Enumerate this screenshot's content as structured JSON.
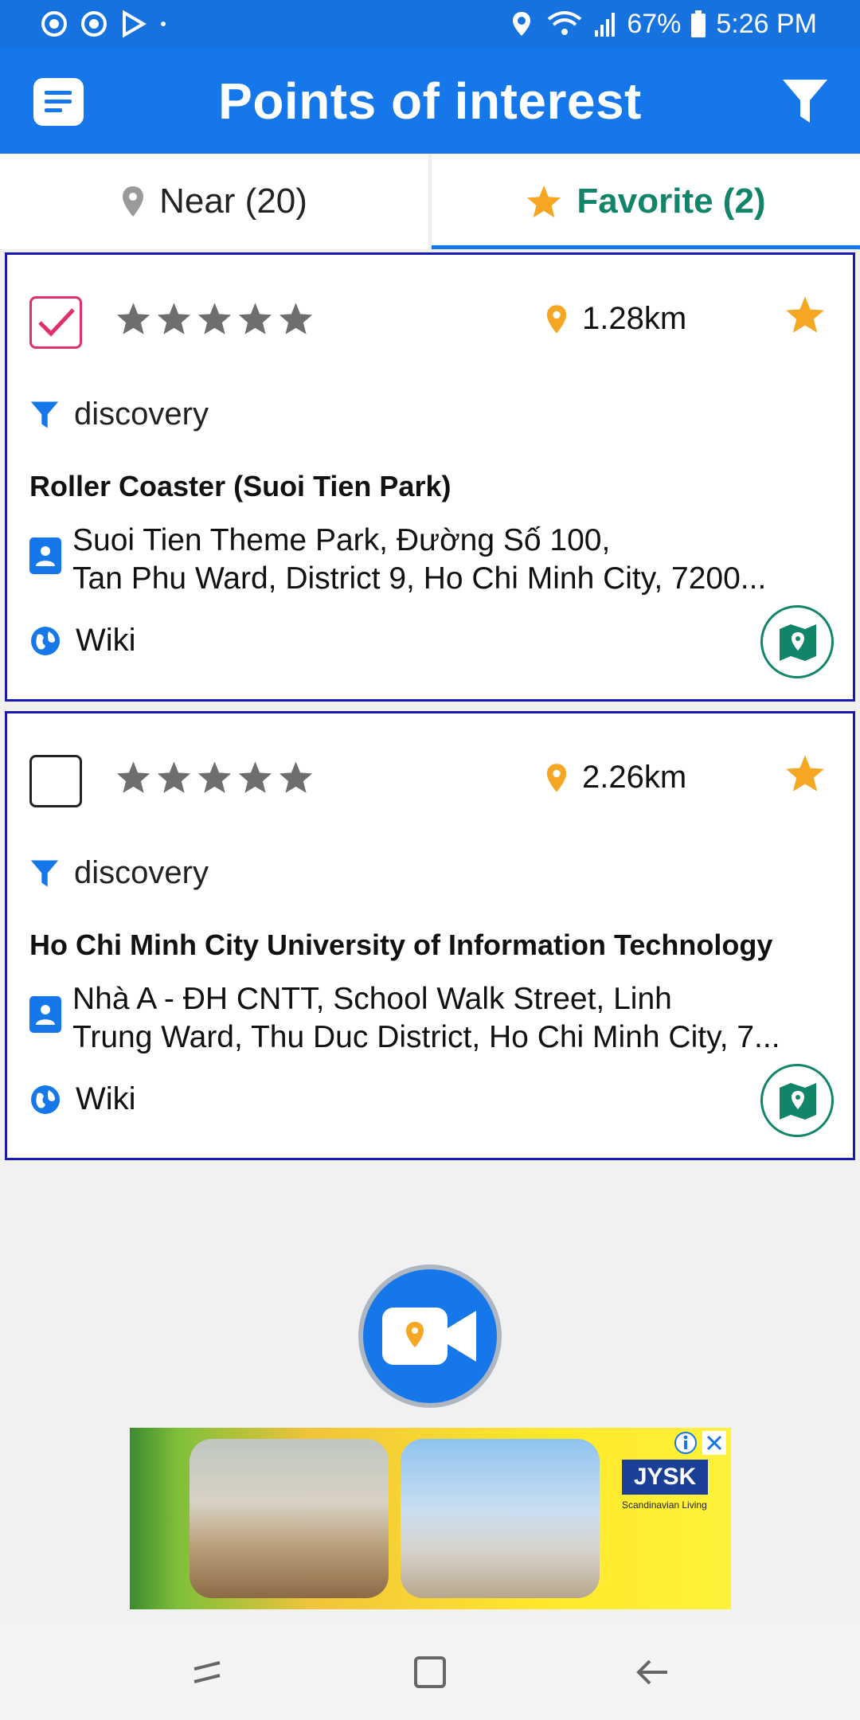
{
  "status_bar": {
    "battery": "67%",
    "time": "5:26 PM"
  },
  "app_bar": {
    "title": "Points of interest"
  },
  "tabs": [
    {
      "label": "Near (20)",
      "icon": "pin-icon",
      "selected": false
    },
    {
      "label": "Favorite (2)",
      "icon": "star-icon",
      "selected": true
    }
  ],
  "pois": [
    {
      "checked": true,
      "rating": 0,
      "distance": "1.28km",
      "favorite": true,
      "category": "discovery",
      "name": "Roller Coaster (Suoi Tien Park)",
      "address_line1": "Suoi Tien Theme Park, Đường Số 100,",
      "address_line2": "Tan Phu Ward, District 9, Ho Chi Minh City, 7200...",
      "link": "Wiki"
    },
    {
      "checked": false,
      "rating": 0,
      "distance": "2.26km",
      "favorite": true,
      "category": "discovery",
      "name": "Ho Chi Minh City University of Information Technology",
      "address_line1": "Nhà A - ĐH CNTT, School Walk Street, Linh",
      "address_line2": "Trung Ward, Thu Duc District, Ho Chi Minh City, 7...",
      "link": "Wiki"
    }
  ],
  "ad": {
    "brand": "JYSK",
    "tagline": "Scandinavian Living"
  },
  "colors": {
    "primary": "#1677ea",
    "accent_green": "#12846a",
    "star_orange": "#f5a623",
    "card_border": "#1a1ab0"
  }
}
